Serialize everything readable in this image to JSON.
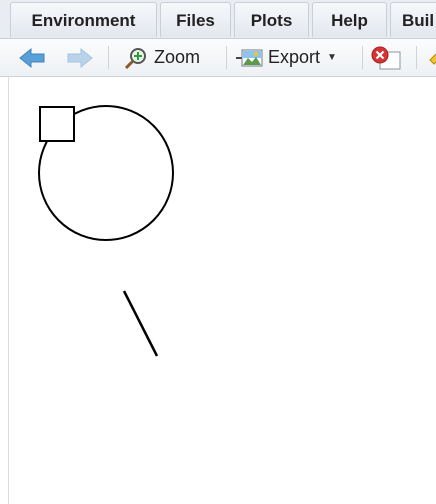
{
  "tabs": [
    {
      "label": "Environment"
    },
    {
      "label": "Files"
    },
    {
      "label": "Plots"
    },
    {
      "label": "Help"
    },
    {
      "label": "Buil"
    }
  ],
  "toolbar": {
    "zoom_label": "Zoom",
    "export_label": "Export",
    "icons": [
      "back-arrow-icon",
      "forward-arrow-icon",
      "zoom-icon",
      "export-icon",
      "remove-plot-icon",
      "clear-all-icon"
    ]
  },
  "colors": {
    "back_arrow": "#5aa0d8",
    "forward_arrow": "#b9d4ea",
    "remove_icon": "#d33434",
    "plot_stroke": "#000000"
  }
}
